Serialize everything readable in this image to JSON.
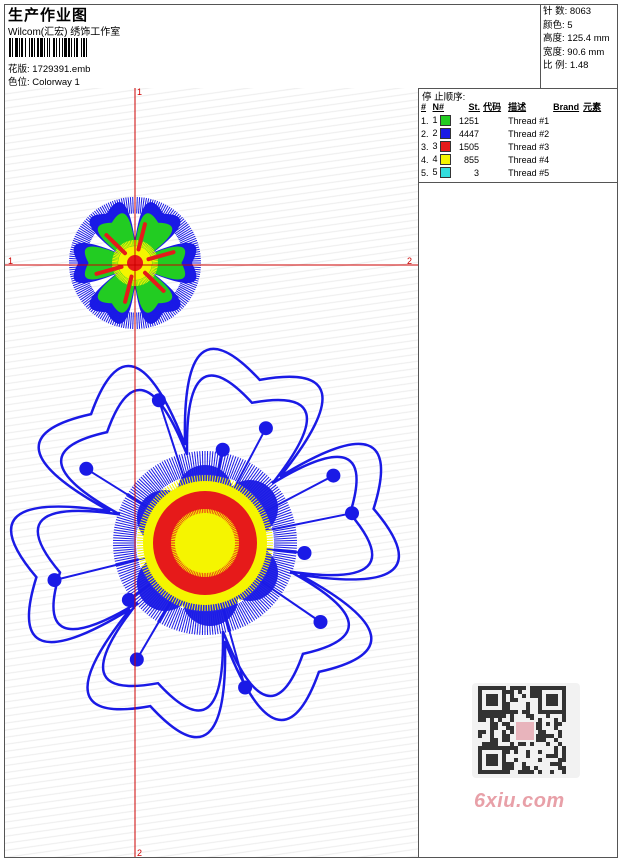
{
  "header": {
    "title": "生产作业图",
    "company": "Wilcom(汇宏) 绣饰工作室",
    "design_label": "花版:",
    "design_value": "1729391.emb",
    "colorway_label": "色位:",
    "colorway_value": "Colorway 1"
  },
  "specs": [
    {
      "label": "针 数:",
      "value": "8063"
    },
    {
      "label": "颜色:",
      "value": "5"
    },
    {
      "label": "高度:",
      "value": "125.4 mm"
    },
    {
      "label": "宽度:",
      "value": "90.6 mm"
    },
    {
      "label": "比 例:",
      "value": "1.48"
    }
  ],
  "stop_sequence": {
    "title": "停 止顺序:",
    "columns": [
      "#",
      "N#",
      "St.",
      "代码",
      "描述",
      "Brand",
      "元素"
    ],
    "rows": [
      {
        "num": "1.",
        "n": "1",
        "color": "#22cc22",
        "st": "1251",
        "desc": "Thread #1"
      },
      {
        "num": "2.",
        "n": "2",
        "color": "#1a1ae6",
        "st": "4447",
        "desc": "Thread #2"
      },
      {
        "num": "3.",
        "n": "3",
        "color": "#e61a1a",
        "st": "1505",
        "desc": "Thread #3"
      },
      {
        "num": "4.",
        "n": "4",
        "color": "#f5f500",
        "st": "855",
        "desc": "Thread #4"
      },
      {
        "num": "5.",
        "n": "5",
        "color": "#33dddd",
        "st": "3",
        "desc": "Thread #5"
      }
    ]
  },
  "guides": {
    "h_left": "1",
    "h_right": "2",
    "v_top": "1",
    "v_bottom": "2"
  },
  "watermark": "6xiu.com",
  "colors": {
    "blue": "#1a1ae6",
    "green": "#22cc22",
    "red": "#e61a1a",
    "yellow": "#f5f500",
    "guide": "#cc0000"
  }
}
